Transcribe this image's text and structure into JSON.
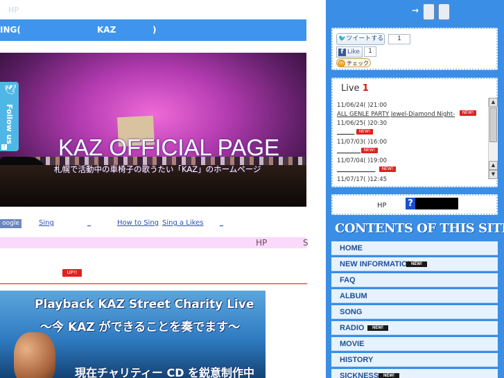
{
  "left": {
    "hp_label": "HP",
    "title": {
      "part1": "ING(",
      "part2": "KAZ",
      "part3": ")"
    },
    "banner": {
      "title": "KAZ OFFICIAL PAGE",
      "subtitle": "札幌で活動中の車椅子の歌うたい「KAZ」のホームページ"
    },
    "follow": {
      "label": "Follow us",
      "bird": "🕊",
      "small": "?"
    },
    "nav": {
      "google": "oogle",
      "links": [
        "Sing",
        "_",
        "How to Sing",
        "Sing a Likes",
        "_"
      ]
    },
    "pink_bar": {
      "hp": "HP",
      "s": "S"
    },
    "up_badge": "UP!!",
    "bottom_image": {
      "line1": "Playback KAZ Street Charity Live",
      "line2": "〜今 KAZ ができることを奏でます〜",
      "line3": "現在チャリティー CD を鋭意制作中"
    }
  },
  "right": {
    "arrow": "→",
    "social": {
      "tweet_label": "ツイートする",
      "tweet_count": "1",
      "like_label": "Like",
      "like_count": "1",
      "mixi_label": "チェック",
      "mixi_icon": "m"
    },
    "live": {
      "title": "Live",
      "count": "1",
      "items": [
        {
          "text": "11/06/24( )21:00",
          "link": false
        },
        {
          "text": "ALL GENLE PARTY Jewel-Diamond Night-",
          "link": true,
          "new": true
        },
        {
          "text": "11/06/25( )20:30",
          "link": false
        },
        {
          "text": "______",
          "link": true,
          "new": true
        },
        {
          "text": "11/07/03( )16:00",
          "link": false
        },
        {
          "text": "________",
          "link": true,
          "new": true
        },
        {
          "text": "11/07/04( )19:00",
          "link": false
        },
        {
          "text": "_____________",
          "link": true,
          "new": true
        },
        {
          "text": "11/07/17( )12:45",
          "link": false
        }
      ],
      "new_label": "NEW!"
    },
    "hp_box": {
      "label": "HP",
      "logo": "?"
    },
    "contents_title": "CONTENTS OF THIS SITE",
    "menu": [
      {
        "label": "HOME",
        "new": false
      },
      {
        "label": "NEW INFORMATION",
        "new": true
      },
      {
        "label": "FAQ",
        "new": false
      },
      {
        "label": "ALBUM",
        "new": false
      },
      {
        "label": "SONG",
        "new": false
      },
      {
        "label": "RADIO",
        "new": true
      },
      {
        "label": "MOVIE",
        "new": false
      },
      {
        "label": "HISTORY",
        "new": false
      },
      {
        "label": "SICKNESS",
        "new": true
      }
    ],
    "menu_new_label": "NEW!"
  },
  "colors": {
    "accent_blue": "#3f95ee",
    "sidebar_blue": "#3a8ee6",
    "new_red": "#e02020",
    "pink": "#fbd9fb"
  }
}
